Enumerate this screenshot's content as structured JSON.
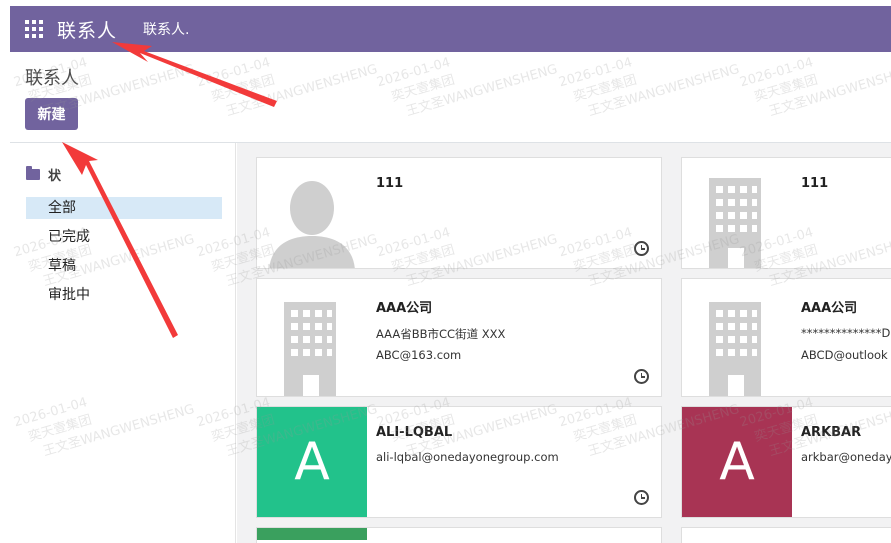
{
  "navbar": {
    "app_name": "联系人",
    "menu_item": "联系人."
  },
  "control_panel": {
    "title": "联系人",
    "new_button": "新建"
  },
  "sidebar": {
    "header": "状",
    "items": [
      {
        "label": "全部",
        "active": true
      },
      {
        "label": "已完成",
        "active": false
      },
      {
        "label": "草稿",
        "active": false
      },
      {
        "label": "审批中",
        "active": false
      }
    ]
  },
  "kanban": {
    "cards": [
      {
        "name": "111",
        "line1": "",
        "line2": "",
        "avatar": "person-placeholder-icon"
      },
      {
        "name": "111",
        "line1": "",
        "line2": "",
        "avatar": "company-building-icon"
      },
      {
        "name": "AAA公司",
        "line1": "AAA省BB市CC街道 XXX",
        "line2": "ABC@163.com",
        "avatar": "company-building-icon"
      },
      {
        "name": "AAA公司",
        "line1": "**************Du",
        "line2": "ABCD@outlook",
        "avatar": "company-building-icon"
      },
      {
        "name": "ALI-LQBAL",
        "line1": "ali-lqbal@onedayonegroup.com",
        "line2": "",
        "avatar_letter": "A",
        "avatar_color": "#22c28b"
      },
      {
        "name": "ARKBAR",
        "line1": "arkbar@oneday",
        "line2": "",
        "avatar_letter": "A",
        "avatar_color": "#a83454"
      }
    ]
  },
  "watermark": {
    "date": "2026-01-04",
    "company": "奕天壹集团",
    "user": "王文圣WANGWENSHENG"
  },
  "colors": {
    "brand": "#71639e",
    "sidebar_active": "#d7e9f7",
    "annotation_arrow": "#f23a3a"
  }
}
